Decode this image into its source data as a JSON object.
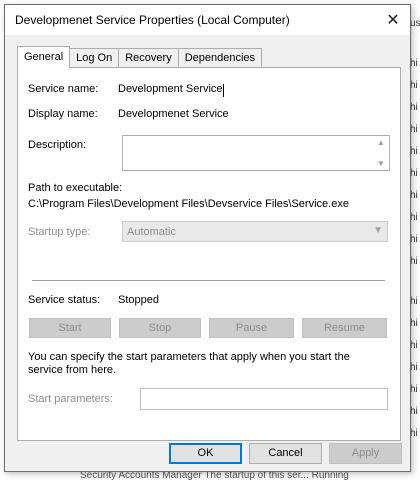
{
  "dialog": {
    "title": "Developmenet Service Properties (Local Computer)",
    "close_glyph": "✕"
  },
  "tabs": [
    {
      "label": "General",
      "active": true
    },
    {
      "label": "Log On",
      "active": false
    },
    {
      "label": "Recovery",
      "active": false
    },
    {
      "label": "Dependencies",
      "active": false
    }
  ],
  "general": {
    "service_name_label": "Service name:",
    "service_name_value": "Development Service",
    "display_name_label": "Display name:",
    "display_name_value": "Developmenet Service",
    "description_label": "Description:",
    "description_value": "",
    "path_label": "Path to executable:",
    "path_value": "C:\\Program Files\\Development Files\\Devservice Files\\Service.exe",
    "startup_type_label": "Startup type:",
    "startup_type_value": "Automatic",
    "service_status_label": "Service status:",
    "service_status_value": "Stopped",
    "start_button": "Start",
    "stop_button": "Stop",
    "pause_button": "Pause",
    "resume_button": "Resume",
    "params_info": "You can specify the start parameters that apply when you start the service from here.",
    "start_params_label": "Start parameters:",
    "start_params_value": ""
  },
  "footer": {
    "ok": "OK",
    "cancel": "Cancel",
    "apply": "Apply"
  },
  "background": {
    "top_fragment": "us",
    "line_fragment": "hi",
    "bottom_text": "Security Accounts Manager  The startup of this ser... Running"
  }
}
